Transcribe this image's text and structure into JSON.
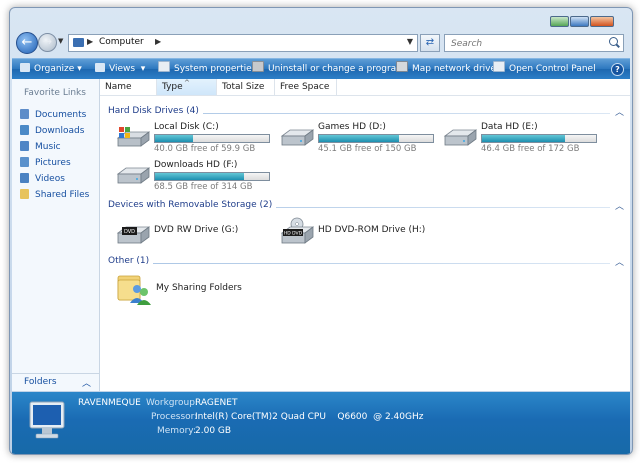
{
  "address": {
    "crumb": "Computer",
    "search_placeholder": "Search"
  },
  "toolbar": {
    "items": [
      {
        "label": "Organize",
        "arrow": "▾"
      },
      {
        "label": "Views",
        "arrow": "▾"
      },
      {
        "label": "System properties"
      },
      {
        "label": "Uninstall or change a program"
      },
      {
        "label": "Map network drive"
      },
      {
        "label": "Open Control Panel"
      }
    ],
    "help": "?"
  },
  "nav": {
    "title": "Favorite Links",
    "links": [
      {
        "label": "Documents",
        "icon": "documents-icon"
      },
      {
        "label": "Downloads",
        "icon": "downloads-icon"
      },
      {
        "label": "Music",
        "icon": "music-icon"
      },
      {
        "label": "Pictures",
        "icon": "pictures-icon"
      },
      {
        "label": "Videos",
        "icon": "videos-icon"
      },
      {
        "label": "Shared Files",
        "icon": "folder-icon"
      }
    ],
    "folders": "Folders",
    "folders_chevron": "︿"
  },
  "columns": [
    "Name",
    "Type",
    "Total Size",
    "Free Space"
  ],
  "sort_indicator": "^",
  "groups": {
    "hdd": {
      "title": "Hard Disk Drives (4)",
      "drives": [
        {
          "name": "Local Disk (C:)",
          "free": "40.0 GB free of 59.9 GB",
          "used_fraction": 0.33,
          "icon": "windows-drive-icon"
        },
        {
          "name": "Games HD (D:)",
          "free": "45.1 GB free of 150 GB",
          "used_fraction": 0.7,
          "icon": "hard-drive-icon"
        },
        {
          "name": "Data HD (E:)",
          "free": "46.4 GB free of 172 GB",
          "used_fraction": 0.73,
          "icon": "hard-drive-icon"
        },
        {
          "name": "Downloads HD (F:)",
          "free": "68.5 GB free of 314 GB",
          "used_fraction": 0.78,
          "icon": "hard-drive-icon"
        }
      ]
    },
    "removable": {
      "title": "Devices with Removable Storage (2)",
      "devices": [
        {
          "name": "DVD RW Drive (G:)",
          "badge": "DVD"
        },
        {
          "name": "HD DVD-ROM Drive (H:)",
          "badge": "HD DVD"
        }
      ]
    },
    "other": {
      "title": "Other (1)",
      "items": [
        {
          "name": "My Sharing Folders"
        }
      ]
    },
    "chevron": "︿"
  },
  "details": {
    "computer": "RAVENMEQUE",
    "workgroup_label": "Workgroup:",
    "workgroup": "RAGENET",
    "processor_label": "Processor:",
    "processor": "Intel(R) Core(TM)2 Quad CPU    Q6600  @ 2.40GHz",
    "memory_label": "Memory:",
    "memory": "2.00 GB"
  },
  "colors": {
    "accent": "#2c77bf",
    "link": "#1750a1",
    "group_title": "#1f3d8a",
    "bar_fill": "#1d8fb0"
  }
}
